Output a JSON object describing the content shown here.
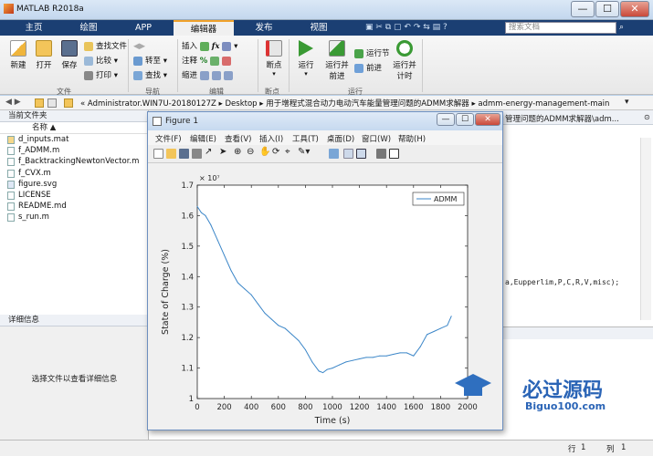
{
  "window": {
    "title": "MATLAB R2018a",
    "min": "—",
    "max": "☐",
    "close": "✕"
  },
  "tabs": [
    "主页",
    "绘图",
    "APP",
    "编辑器",
    "发布",
    "视图"
  ],
  "search": {
    "placeholder": "搜索文档"
  },
  "ribbon": {
    "file": {
      "new": "新建",
      "open": "打开",
      "save": "保存",
      "find_files": "查找文件",
      "compare": "比较",
      "print": "打印",
      "label": "文件"
    },
    "navigate": {
      "goto": "转至",
      "find": "查找",
      "label": "导航"
    },
    "edit": {
      "insert": "插入",
      "fx": "fx",
      "comment": "注释",
      "indent": "缩进",
      "label": "编辑"
    },
    "breakpoints": {
      "breakpoints": "断点",
      "label": "断点"
    },
    "run": {
      "run": "运行",
      "run_advance": "运行并\n前进",
      "run_section": "运行节",
      "advance": "前进",
      "run_time": "运行并\n计时",
      "label": "运行"
    }
  },
  "address": {
    "path": "« Administrator.WIN7U-20180127Z ▸ Desktop ▸ 用于增程式混合动力电动汽车能量管理问题的ADMM求解器 ▸ admm-energy-management-main"
  },
  "current_folder": {
    "title": "当前文件夹",
    "column": "名称 ▲",
    "files": [
      "d_inputs.mat",
      "f_ADMM.m",
      "f_BacktrackingNewtonVector.m",
      "f_CVX.m",
      "figure.svg",
      "LICENSE",
      "README.md",
      "s_run.m"
    ]
  },
  "details": {
    "title": "详细信息",
    "hint": "选择文件以查看详细信息"
  },
  "editor": {
    "tab_path": "管理问题的ADMM求解器\\adm...",
    "code_fragment": "a,Eupperlim,P,C,R,V,misc);"
  },
  "status": {
    "row_label": "行",
    "row": "1",
    "col_label": "列",
    "col": "1"
  },
  "figure": {
    "title": "Figure 1",
    "menu": [
      "文件(F)",
      "编辑(E)",
      "查看(V)",
      "插入(I)",
      "工具(T)",
      "桌面(D)",
      "窗口(W)",
      "帮助(H)"
    ]
  },
  "watermark": {
    "text": "必过源码",
    "sub": "Biguo100.com"
  },
  "chart_data": {
    "type": "line",
    "xlabel": "Time (s)",
    "ylabel": "State of Charge (%)",
    "exponent": "× 10⁷",
    "xlim": [
      0,
      2000
    ],
    "ylim": [
      1,
      1.7
    ],
    "xticks": [
      "0",
      "200",
      "400",
      "600",
      "800",
      "1000",
      "1200",
      "1400",
      "1600",
      "1800",
      "2000"
    ],
    "yticks": [
      "1",
      "1.1",
      "1.2",
      "1.3",
      "1.4",
      "1.5",
      "1.6",
      "1.7"
    ],
    "legend": "top-right",
    "series": [
      {
        "name": "ADMM",
        "color": "#3b86c8",
        "x": [
          0,
          30,
          60,
          100,
          150,
          200,
          250,
          300,
          350,
          400,
          450,
          500,
          550,
          600,
          650,
          700,
          750,
          800,
          850,
          900,
          930,
          960,
          1000,
          1050,
          1100,
          1150,
          1200,
          1250,
          1300,
          1350,
          1400,
          1450,
          1500,
          1550,
          1600,
          1650,
          1700,
          1750,
          1800,
          1850,
          1880
        ],
        "y": [
          1.63,
          1.61,
          1.6,
          1.57,
          1.52,
          1.47,
          1.42,
          1.38,
          1.36,
          1.34,
          1.31,
          1.28,
          1.26,
          1.24,
          1.23,
          1.21,
          1.19,
          1.16,
          1.12,
          1.09,
          1.085,
          1.095,
          1.1,
          1.11,
          1.12,
          1.125,
          1.13,
          1.135,
          1.135,
          1.14,
          1.14,
          1.145,
          1.15,
          1.15,
          1.14,
          1.17,
          1.21,
          1.22,
          1.23,
          1.24,
          1.27
        ]
      }
    ]
  }
}
